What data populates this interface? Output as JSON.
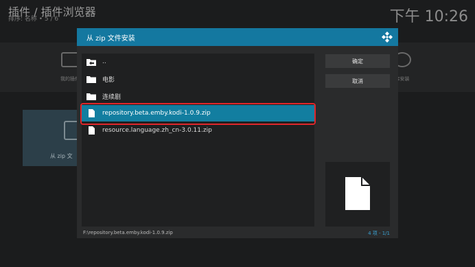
{
  "background": {
    "title": "插件 / 插件浏览器",
    "subtitle": "排序: 名称 • 5 / 6",
    "clock": "下午 10:26",
    "tiles": [
      "我的插件",
      "从 zip 文",
      "库安装"
    ]
  },
  "dialog": {
    "title": "从 zip 文件安装",
    "items": [
      {
        "label": "..",
        "icon": "folder-up-icon"
      },
      {
        "label": "电影",
        "icon": "folder-icon"
      },
      {
        "label": "连续剧",
        "icon": "folder-icon"
      },
      {
        "label": "repository.beta.emby.kodi-1.0.9.zip",
        "icon": "file-icon",
        "selected": true
      },
      {
        "label": "resource.language.zh_cn-3.0.11.zip",
        "icon": "file-icon"
      }
    ],
    "ok_label": "确定",
    "cancel_label": "取消",
    "preview_icon": "file-icon",
    "path": "F:\\repository.beta.emby.kodi-1.0.9.zip",
    "count": "4 项 - 1/1"
  },
  "colors": {
    "accent": "#1478a0",
    "selection": "#127ea0",
    "highlight_border": "#e0262a"
  }
}
